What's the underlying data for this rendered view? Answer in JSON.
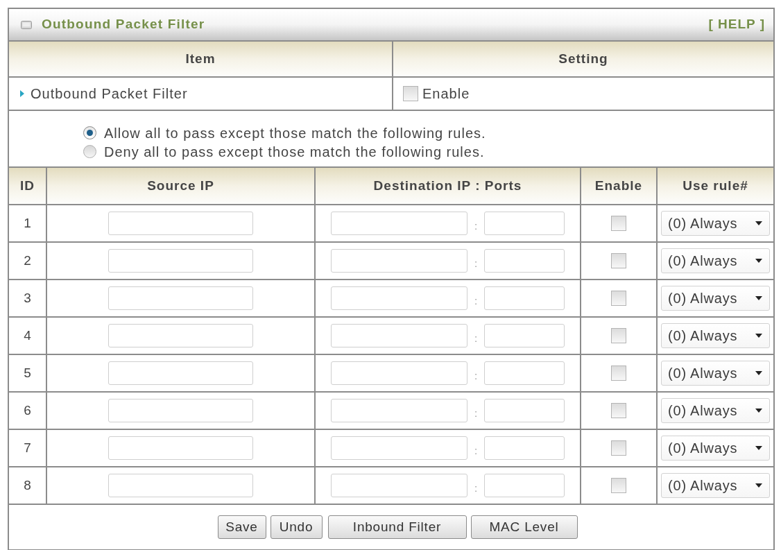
{
  "panel": {
    "title": "Outbound Packet Filter",
    "help_link": "[ HELP ]"
  },
  "settings_table": {
    "columns": [
      "Item",
      "Setting"
    ],
    "rows": [
      {
        "label": "Outbound Packet Filter",
        "checkbox_label": "Enable",
        "checked": false
      }
    ]
  },
  "policy": [
    {
      "label": "Allow all to pass except those match the following rules.",
      "selected": true
    },
    {
      "label": "Deny all to pass except those match the following rules.",
      "selected": false
    }
  ],
  "rules_table": {
    "columns": [
      "ID",
      "Source IP",
      "Destination IP : Ports",
      "Enable",
      "Use rule#"
    ],
    "rows": [
      {
        "id": "1",
        "separator": ":",
        "enabled": false,
        "schedule": "(0) Always"
      },
      {
        "id": "2",
        "separator": ":",
        "enabled": false,
        "schedule": "(0) Always"
      },
      {
        "id": "3",
        "separator": ":",
        "enabled": false,
        "schedule": "(0) Always"
      },
      {
        "id": "4",
        "separator": ":",
        "enabled": false,
        "schedule": "(0) Always"
      },
      {
        "id": "5",
        "separator": ":",
        "enabled": false,
        "schedule": "(0) Always"
      },
      {
        "id": "6",
        "separator": ":",
        "enabled": false,
        "schedule": "(0) Always"
      },
      {
        "id": "7",
        "separator": ":",
        "enabled": false,
        "schedule": "(0) Always"
      },
      {
        "id": "8",
        "separator": ":",
        "enabled": false,
        "schedule": "(0) Always"
      }
    ]
  },
  "buttons": [
    "Save",
    "Undo",
    "Inbound Filter",
    "MAC Level"
  ]
}
